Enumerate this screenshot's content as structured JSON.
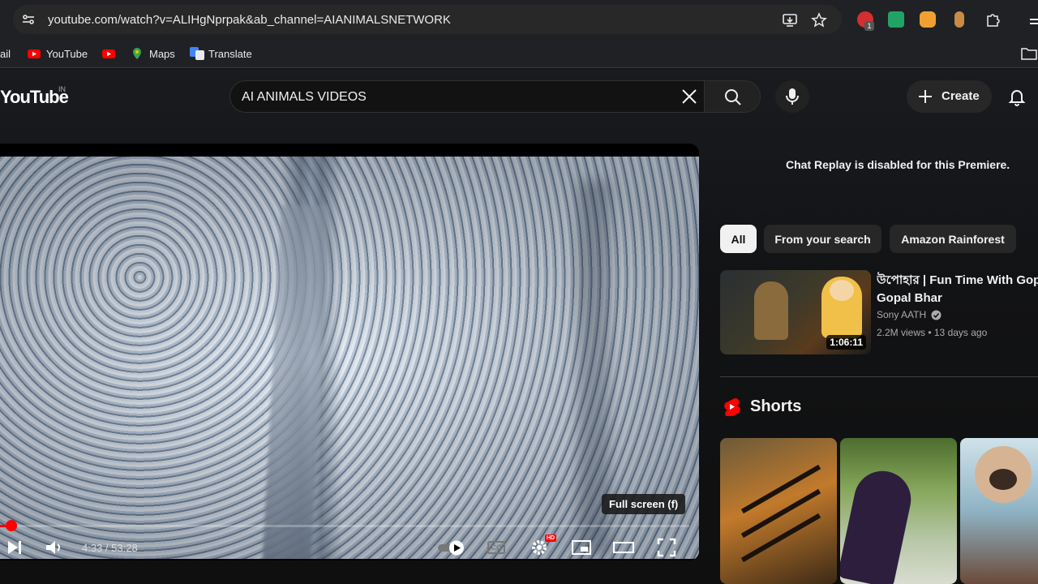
{
  "browser": {
    "url": "youtube.com/watch?v=ALIHgNprpak&ab_channel=AIANIMALSNETWORK",
    "bookmarks": [
      {
        "label": "ail",
        "icon": "gmail-icon"
      },
      {
        "label": "YouTube",
        "icon": "youtube-icon"
      },
      {
        "label": "",
        "icon": "youtube-icon"
      },
      {
        "label": "Maps",
        "icon": "maps-icon"
      },
      {
        "label": "Translate",
        "icon": "translate-icon"
      }
    ],
    "extensions": [
      "adblock-icon",
      "sheets-icon",
      "honey-icon",
      "extension-icon",
      "puzzle-icon"
    ],
    "adblock_count": "1"
  },
  "header": {
    "logo": "YouTube",
    "country": "IN",
    "search_value": "AI ANIMALS VIDEOS",
    "create_label": "Create"
  },
  "player": {
    "tooltip": "Full screen (f)",
    "time": "4:33 / 53:28",
    "progress_fraction": 0.085,
    "hd_badge": "HD",
    "cc_label": "CC"
  },
  "sidebar": {
    "chat_replay": "Chat Replay is disabled for this Premiere.",
    "chips": [
      "All",
      "From your search",
      "Amazon Rainforest"
    ],
    "recommendation": {
      "title_line1": "উপোহার | Fun Time With Gop",
      "title_line2": "Gopal Bhar",
      "channel": "Sony AATH",
      "meta": "2.2M views • 13 days ago",
      "duration": "1:06:11"
    },
    "shorts_label": "Shorts"
  },
  "colors": {
    "accent": "#ff0000",
    "background": "#0f0f0f",
    "chip_bg": "#272727"
  }
}
